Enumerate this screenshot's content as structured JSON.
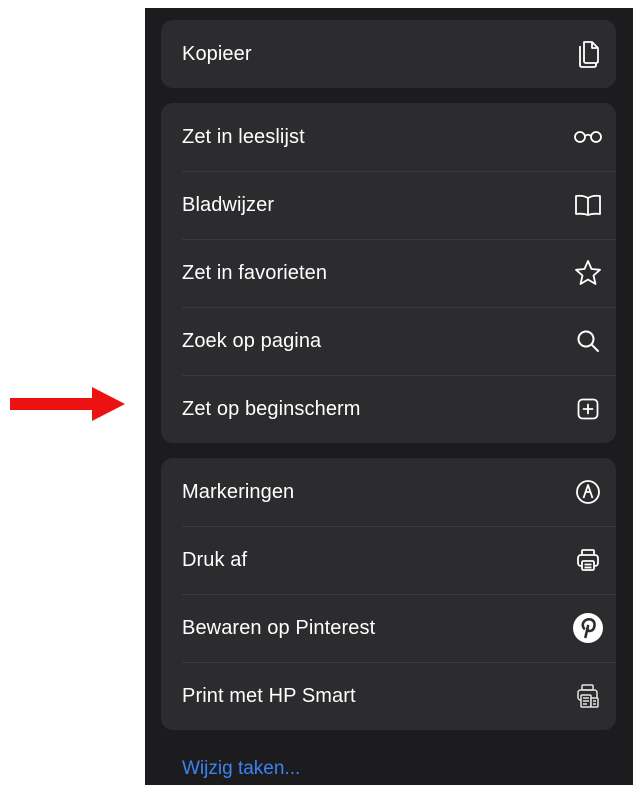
{
  "colors": {
    "arrow": "#ee1111",
    "sheet_background": "#1c1c1e",
    "group_background": "#2c2c2e",
    "text": "#ffffff",
    "link": "#3b82f6",
    "pinterest_badge": "#ffffff"
  },
  "menu": {
    "groups": [
      {
        "items": [
          {
            "label": "Kopieer",
            "icon": "copy-icon"
          }
        ]
      },
      {
        "items": [
          {
            "label": "Zet in leeslijst",
            "icon": "glasses-icon"
          },
          {
            "label": "Bladwijzer",
            "icon": "book-icon"
          },
          {
            "label": "Zet in favorieten",
            "icon": "star-icon"
          },
          {
            "label": "Zoek op pagina",
            "icon": "search-icon"
          },
          {
            "label": "Zet op beginscherm",
            "icon": "add-square-icon"
          }
        ]
      },
      {
        "items": [
          {
            "label": "Markeringen",
            "icon": "markup-icon"
          },
          {
            "label": "Druk af",
            "icon": "printer-icon"
          },
          {
            "label": "Bewaren op Pinterest",
            "icon": "pinterest-icon"
          },
          {
            "label": "Print met HP Smart",
            "icon": "hp-smart-icon"
          }
        ]
      }
    ]
  },
  "footer": {
    "edit_actions_label": "Wijzig taken..."
  }
}
